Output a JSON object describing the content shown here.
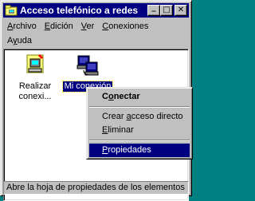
{
  "window": {
    "title": "Acceso telefónico a redes",
    "minimize_glyph": "_",
    "maximize_glyph": "□",
    "close_glyph": "✕"
  },
  "menu": {
    "row1": [
      "Archivo",
      "Edición",
      "Ver",
      "Conexiones"
    ],
    "row2": [
      "Ayuda"
    ],
    "underline_index": {
      "Archivo": 0,
      "Edición": 0,
      "Ver": 0,
      "Conexiones": 0,
      "Ayuda": 1
    }
  },
  "items": [
    {
      "label_line1": "Realizar",
      "label_line2": "conexi...",
      "icon": "new-connection-icon",
      "selected": false
    },
    {
      "label_line1": "Mi conexión",
      "label_line2": "",
      "icon": "connection-icon",
      "selected": true
    }
  ],
  "context_menu": {
    "items": [
      {
        "label": "Conectar",
        "underline": 1,
        "bold": true,
        "highlighted": false
      },
      {
        "separator": true
      },
      {
        "label": "Crear acceso directo",
        "underline": 6,
        "bold": false,
        "highlighted": false
      },
      {
        "label": "Eliminar",
        "underline": 0,
        "bold": false,
        "highlighted": false
      },
      {
        "separator": true
      },
      {
        "label": "Propiedades",
        "underline": 0,
        "bold": false,
        "highlighted": true
      }
    ]
  },
  "status": {
    "text": "Abre la hoja de propiedades de los elementos"
  },
  "colors": {
    "titlebar": "#000080",
    "face": "#c0c0c0",
    "highlight": "#000080"
  }
}
